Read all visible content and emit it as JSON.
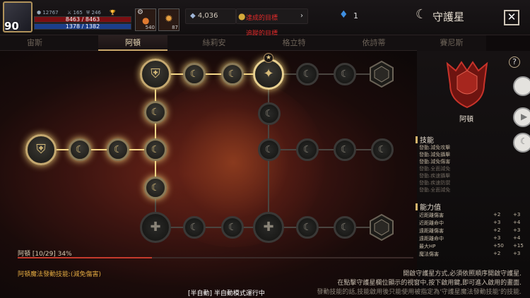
{
  "header": {
    "level": "90",
    "stats": [
      "12767",
      "165",
      "246"
    ],
    "hp": "8463 / 8463",
    "mp": "1378 / 1382",
    "slot1_count": "540",
    "slot2_count": "87",
    "currency": "4,036",
    "red_line1": "達成的目標",
    "red_line2": "追蹤的目標",
    "gem_count": "1",
    "title": "守護星",
    "close": "✕"
  },
  "tabs": [
    "宙斯",
    "阿頓",
    "絲莉安",
    "格立特",
    "依詩蒂",
    "賽尼斯"
  ],
  "active_tab": 1,
  "progress": {
    "label": "阿頓 [10/29] 34%",
    "value": 0.34
  },
  "bottom": {
    "skill_text": "阿頓魔法發動技能:(減免傷害)",
    "hint1": "開啟守護星方式,必須依照順序開啟守護星.",
    "hint2": "在點擊守護星欄位顯示的視窗中,按下啟用鍵,即可進入啟用的畫面.",
    "hint3": "發動技能的話,技能啟用後只能使用被指定為'守護星魔法發動技能'的技能.",
    "auto_mode": "[半自動] 半自動模式運行中"
  },
  "panel": {
    "emblem_label": "阿頓",
    "help": "?",
    "skills_header": "技能",
    "skills": [
      {
        "text": "發動.減免攻擊",
        "active": true
      },
      {
        "text": "發動.減免攝擊",
        "active": true
      },
      {
        "text": "發動.減免傷害",
        "active": true
      },
      {
        "text": "發動.全面減免",
        "active": false
      },
      {
        "text": "發動.疾速攝擊",
        "active": false
      },
      {
        "text": "發動.疾速防禦",
        "active": false
      },
      {
        "text": "發動.全面減免",
        "active": false
      }
    ],
    "ability_header": "能力值",
    "abilities": [
      {
        "name": "近距離傷害",
        "v1": "+2",
        "v2": "+3"
      },
      {
        "name": "近距離命中",
        "v1": "+3",
        "v2": "+4"
      },
      {
        "name": "遠距離傷害",
        "v1": "+2",
        "v2": "+3"
      },
      {
        "name": "遠距離命中",
        "v1": "+3",
        "v2": "+4"
      },
      {
        "name": "最大HP",
        "v1": "+50",
        "v2": "+15"
      },
      {
        "name": "魔法傷害",
        "v1": "+2",
        "v2": "+3"
      }
    ]
  },
  "colors": {
    "accent": "#c9a76a",
    "hp": "#7a0f12",
    "mp": "#1c3e8a",
    "progress": "#c43a2c"
  }
}
